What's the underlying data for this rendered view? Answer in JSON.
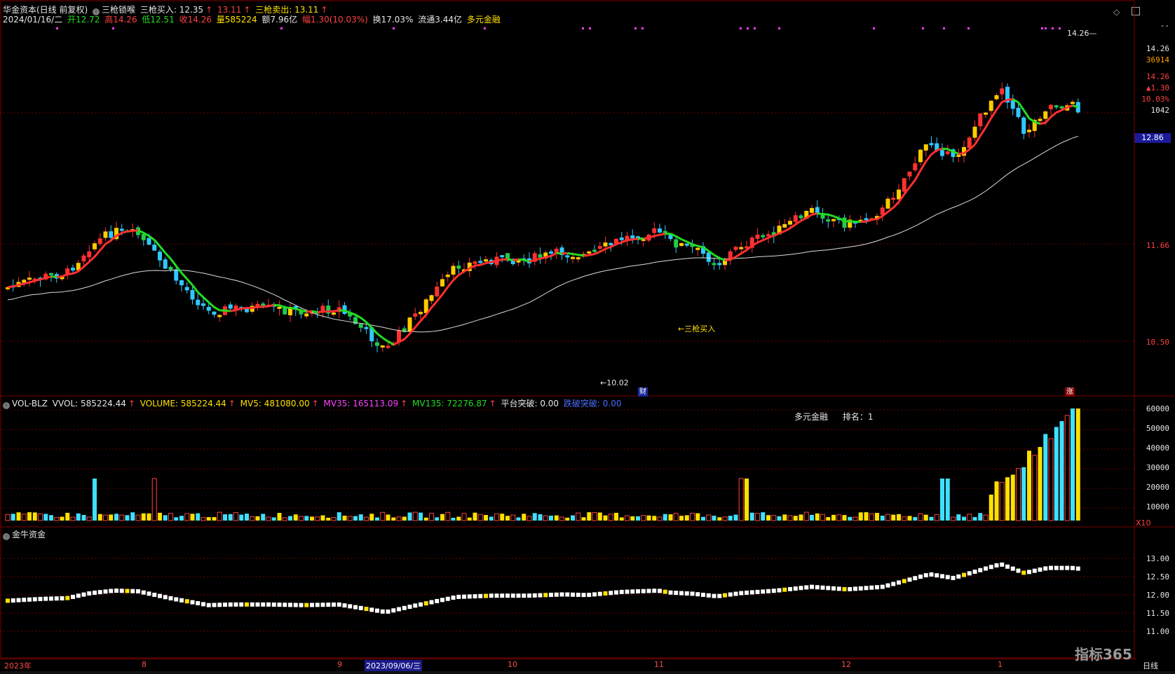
{
  "header": {
    "title": "华金资本(日线 前复权)",
    "ind_name": "三枪锁喉",
    "buy_label": "三枪买入: 12.35",
    "buy_extra": "13.11",
    "sell_label": "三枪卖出: 13.11"
  },
  "quote": {
    "date": "2024/01/16/二",
    "open": "开12.72",
    "high": "高14.26",
    "low": "低12.51",
    "close": "收14.26",
    "vol": "量585224",
    "amt": "额7.96亿",
    "chg": "幅1.30(10.03%)",
    "turnover": "换17.03%",
    "float": "流通3.44亿",
    "concept": "多元金融"
  },
  "main_axis": {
    "top": "--",
    "p1": "14.26",
    "p2": "36914",
    "p3": "14.26",
    "p4": "▲1.30",
    "p5": "10.03%",
    "p6": "1042",
    "current": "12.86",
    "l1": "11.66",
    "l2": "10.50"
  },
  "annotations": {
    "high_label": "14.26",
    "low_label": "10.02",
    "buy_mark": "三枪买入",
    "cai": "财",
    "zhang": "涨"
  },
  "vol_header": {
    "name": "VOL-BLZ",
    "vvol": "VVOL: 585224.44",
    "volume": "VOLUME: 585224.44",
    "mv5": "MV5: 481080.00",
    "mv35": "MV35: 165113.09",
    "mv135": "MV135: 72276.87",
    "pt": "平台突破: 0.00",
    "dj": "跌破突破: 0.00"
  },
  "vol_info": {
    "sector": "多元金融",
    "rank": "排名：1"
  },
  "vol_axis": [
    "60000",
    "50000",
    "40000",
    "30000",
    "20000",
    "10000"
  ],
  "vol_unit": "X10",
  "jn_header": {
    "name": "金牛资金"
  },
  "jn_axis": [
    "13.00",
    "12.50",
    "12.00",
    "11.50",
    "11.00"
  ],
  "dates": {
    "d0": "2023年",
    "d1": "8",
    "d2": "9",
    "d3": "2023/09/06/三",
    "d4": "10",
    "d5": "11",
    "d6": "12",
    "d7": "1"
  },
  "right_labels": {
    "period": "日线"
  },
  "watermark": "指标365",
  "colors": {
    "up": "#ff3030",
    "down": "#30c0ff",
    "ma_up": "#ff3030",
    "ma_down": "#22dd22",
    "thin": "#ffff66"
  }
}
